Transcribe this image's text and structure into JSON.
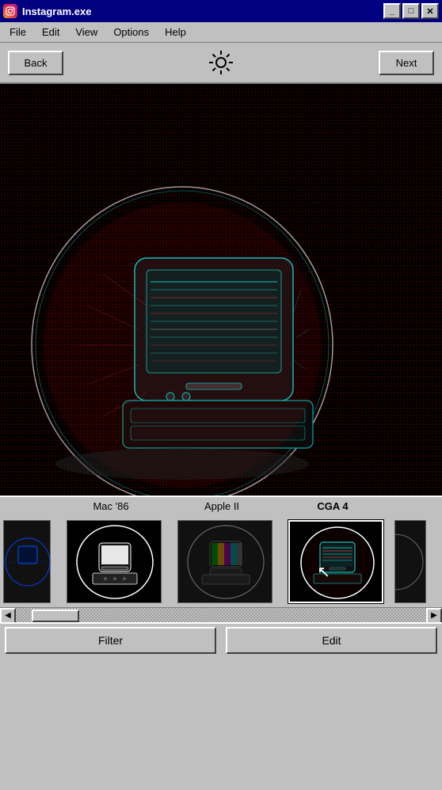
{
  "titleBar": {
    "title": "Instagram.exe",
    "buttons": {
      "minimize": "_",
      "maximize": "□",
      "close": "✕"
    }
  },
  "menuBar": {
    "items": [
      "File",
      "Edit",
      "View",
      "Options",
      "Help"
    ]
  },
  "toolbar": {
    "back_label": "Back",
    "next_label": "Next"
  },
  "filterStrip": {
    "filters": [
      {
        "id": "partial-left",
        "label": "",
        "selected": false
      },
      {
        "id": "mac86",
        "label": "Mac '86",
        "selected": false
      },
      {
        "id": "apple2",
        "label": "Apple II",
        "selected": false
      },
      {
        "id": "cga4",
        "label": "CGA 4",
        "selected": true
      },
      {
        "id": "partial-right",
        "label": "",
        "selected": false
      }
    ]
  },
  "bottomBar": {
    "filter_label": "Filter",
    "edit_label": "Edit"
  },
  "colors": {
    "titleBarBg": "#000080",
    "bodyBg": "#c0c0c0",
    "accent": "#000080"
  }
}
